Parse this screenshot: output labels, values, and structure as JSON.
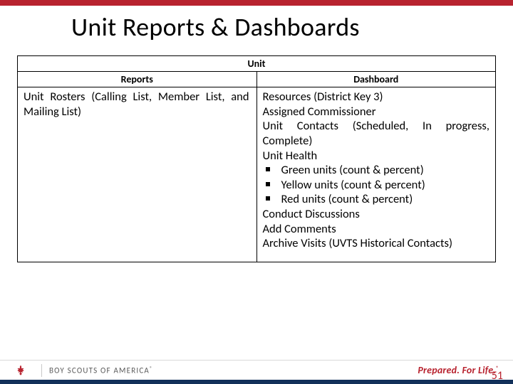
{
  "title": "Unit Reports & Dashboards",
  "table": {
    "heading_full": "Unit",
    "col1_heading": "Reports",
    "col2_heading": "Dashboard",
    "col1_body": "Unit Rosters (Calling List, Member List, and Mailing List)",
    "col2_line1": "Resources (District Key 3)",
    "col2_line2": "Assigned Commissioner",
    "col2_line3": "Unit Contacts (Scheduled, In progress, Complete)",
    "col2_line4": "Unit Health",
    "col2_bullet1": "Green units (count & percent)",
    "col2_bullet2": "Yellow units (count & percent)",
    "col2_bullet3": "Red units (count & percent)",
    "col2_line5": "Conduct Discussions",
    "col2_line6": "Add Comments",
    "col2_line7": "Archive Visits (UVTS Historical Contacts)"
  },
  "footer": {
    "brand": "BOY SCOUTS OF AMERICA",
    "tagline": "Prepared. For Life.",
    "pagenum": "51",
    "reg": "®"
  }
}
